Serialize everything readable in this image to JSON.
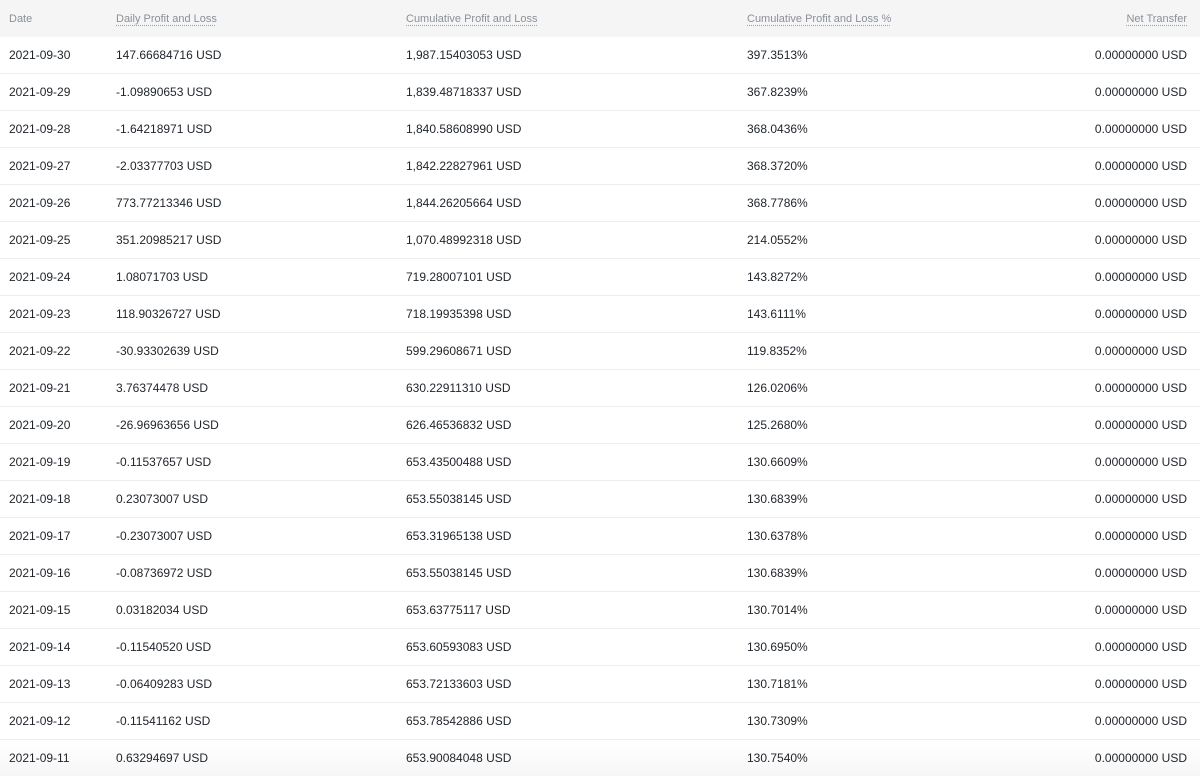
{
  "table": {
    "headers": {
      "date": "Date",
      "daily": "Daily Profit and Loss",
      "cumulative": "Cumulative Profit and Loss",
      "cumulative_pct": "Cumulative Profit and Loss %",
      "net_transfer": "Net Transfer"
    },
    "rows": [
      {
        "date": "2021-09-30",
        "daily": "147.66684716 USD",
        "cumulative": "1,987.15403053 USD",
        "cumulative_pct": "397.3513%",
        "net_transfer": "0.00000000 USD"
      },
      {
        "date": "2021-09-29",
        "daily": "-1.09890653 USD",
        "cumulative": "1,839.48718337 USD",
        "cumulative_pct": "367.8239%",
        "net_transfer": "0.00000000 USD"
      },
      {
        "date": "2021-09-28",
        "daily": "-1.64218971 USD",
        "cumulative": "1,840.58608990 USD",
        "cumulative_pct": "368.0436%",
        "net_transfer": "0.00000000 USD"
      },
      {
        "date": "2021-09-27",
        "daily": "-2.03377703 USD",
        "cumulative": "1,842.22827961 USD",
        "cumulative_pct": "368.3720%",
        "net_transfer": "0.00000000 USD"
      },
      {
        "date": "2021-09-26",
        "daily": "773.77213346 USD",
        "cumulative": "1,844.26205664 USD",
        "cumulative_pct": "368.7786%",
        "net_transfer": "0.00000000 USD"
      },
      {
        "date": "2021-09-25",
        "daily": "351.20985217 USD",
        "cumulative": "1,070.48992318 USD",
        "cumulative_pct": "214.0552%",
        "net_transfer": "0.00000000 USD"
      },
      {
        "date": "2021-09-24",
        "daily": "1.08071703 USD",
        "cumulative": "719.28007101 USD",
        "cumulative_pct": "143.8272%",
        "net_transfer": "0.00000000 USD"
      },
      {
        "date": "2021-09-23",
        "daily": "118.90326727 USD",
        "cumulative": "718.19935398 USD",
        "cumulative_pct": "143.6111%",
        "net_transfer": "0.00000000 USD"
      },
      {
        "date": "2021-09-22",
        "daily": "-30.93302639 USD",
        "cumulative": "599.29608671 USD",
        "cumulative_pct": "119.8352%",
        "net_transfer": "0.00000000 USD"
      },
      {
        "date": "2021-09-21",
        "daily": "3.76374478 USD",
        "cumulative": "630.22911310 USD",
        "cumulative_pct": "126.0206%",
        "net_transfer": "0.00000000 USD"
      },
      {
        "date": "2021-09-20",
        "daily": "-26.96963656 USD",
        "cumulative": "626.46536832 USD",
        "cumulative_pct": "125.2680%",
        "net_transfer": "0.00000000 USD"
      },
      {
        "date": "2021-09-19",
        "daily": "-0.11537657 USD",
        "cumulative": "653.43500488 USD",
        "cumulative_pct": "130.6609%",
        "net_transfer": "0.00000000 USD"
      },
      {
        "date": "2021-09-18",
        "daily": "0.23073007 USD",
        "cumulative": "653.55038145 USD",
        "cumulative_pct": "130.6839%",
        "net_transfer": "0.00000000 USD"
      },
      {
        "date": "2021-09-17",
        "daily": "-0.23073007 USD",
        "cumulative": "653.31965138 USD",
        "cumulative_pct": "130.6378%",
        "net_transfer": "0.00000000 USD"
      },
      {
        "date": "2021-09-16",
        "daily": "-0.08736972 USD",
        "cumulative": "653.55038145 USD",
        "cumulative_pct": "130.6839%",
        "net_transfer": "0.00000000 USD"
      },
      {
        "date": "2021-09-15",
        "daily": "0.03182034 USD",
        "cumulative": "653.63775117 USD",
        "cumulative_pct": "130.7014%",
        "net_transfer": "0.00000000 USD"
      },
      {
        "date": "2021-09-14",
        "daily": "-0.11540520 USD",
        "cumulative": "653.60593083 USD",
        "cumulative_pct": "130.6950%",
        "net_transfer": "0.00000000 USD"
      },
      {
        "date": "2021-09-13",
        "daily": "-0.06409283 USD",
        "cumulative": "653.72133603 USD",
        "cumulative_pct": "130.7181%",
        "net_transfer": "0.00000000 USD"
      },
      {
        "date": "2021-09-12",
        "daily": "-0.11541162 USD",
        "cumulative": "653.78542886 USD",
        "cumulative_pct": "130.7309%",
        "net_transfer": "0.00000000 USD"
      },
      {
        "date": "2021-09-11",
        "daily": "0.63294697 USD",
        "cumulative": "653.90084048 USD",
        "cumulative_pct": "130.7540%",
        "net_transfer": "0.00000000 USD"
      }
    ]
  }
}
